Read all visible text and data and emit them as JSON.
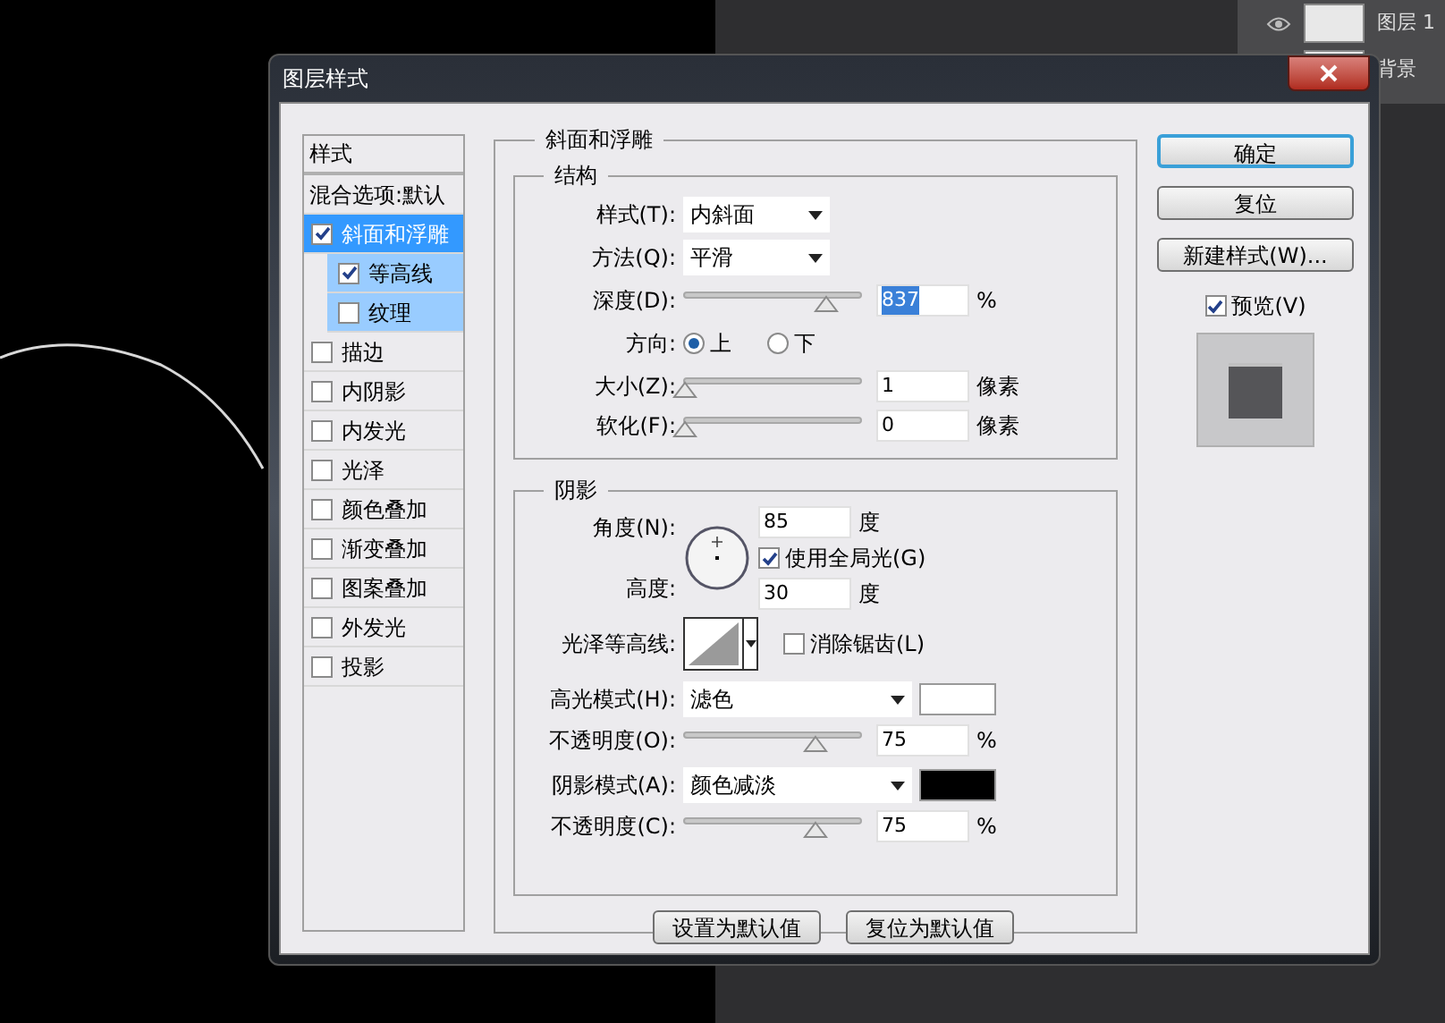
{
  "layers_panel": {
    "layers": [
      {
        "name": "图层 1"
      },
      {
        "name": "背景"
      }
    ]
  },
  "dialog": {
    "title": "图层样式",
    "styles_header": "样式",
    "styles": [
      {
        "kind": "header",
        "label": "混合选项:默认",
        "selected": false
      },
      {
        "kind": "checkbox",
        "label": "斜面和浮雕",
        "checked": true,
        "selected": true,
        "children": [
          {
            "label": "等高线",
            "checked": true
          },
          {
            "label": "纹理",
            "checked": false
          }
        ]
      },
      {
        "kind": "checkbox",
        "label": "描边",
        "checked": false,
        "selected": false
      },
      {
        "kind": "checkbox",
        "label": "内阴影",
        "checked": false,
        "selected": false
      },
      {
        "kind": "checkbox",
        "label": "内发光",
        "checked": false,
        "selected": false
      },
      {
        "kind": "checkbox",
        "label": "光泽",
        "checked": false,
        "selected": false
      },
      {
        "kind": "checkbox",
        "label": "颜色叠加",
        "checked": false,
        "selected": false
      },
      {
        "kind": "checkbox",
        "label": "渐变叠加",
        "checked": false,
        "selected": false
      },
      {
        "kind": "checkbox",
        "label": "图案叠加",
        "checked": false,
        "selected": false
      },
      {
        "kind": "checkbox",
        "label": "外发光",
        "checked": false,
        "selected": false
      },
      {
        "kind": "checkbox",
        "label": "投影",
        "checked": false,
        "selected": false
      }
    ],
    "section_title": "斜面和浮雕",
    "structure": {
      "title": "结构",
      "style": {
        "label": "样式(T):",
        "value": "内斜面"
      },
      "technique": {
        "label": "方法(Q):",
        "value": "平滑"
      },
      "depth": {
        "label": "深度(D):",
        "value": "837",
        "unit": "%",
        "level": 0.81,
        "highlighted": true
      },
      "direction": {
        "label": "方向:",
        "options": [
          {
            "label": "上",
            "selected": true
          },
          {
            "label": "下",
            "selected": false
          }
        ]
      },
      "size": {
        "label": "大小(Z):",
        "value": "1",
        "unit": "像素",
        "level": 0,
        "highlighted": false
      },
      "soften": {
        "label": "软化(F):",
        "value": "0",
        "unit": "像素",
        "level": 0,
        "highlighted": false
      }
    },
    "shading": {
      "title": "阴影",
      "angle": {
        "label": "角度(N):",
        "value": "85",
        "unit": "度"
      },
      "global_light": {
        "label": "使用全局光(G)",
        "checked": true
      },
      "altitude": {
        "label": "高度:",
        "value": "30",
        "unit": "度"
      },
      "gloss_contour": {
        "label": "光泽等高线:"
      },
      "anti_aliased": {
        "label": "消除锯齿(L)",
        "checked": false
      },
      "highlight_mode": {
        "label": "高光模式(H):",
        "value": "滤色",
        "color": "#ffffff"
      },
      "highlight_opacity": {
        "label": "不透明度(O):",
        "value": "75",
        "unit": "%",
        "level": 0.74,
        "highlighted": false
      },
      "shadow_mode": {
        "label": "阴影模式(A):",
        "value": "颜色减淡",
        "color": "#000000"
      },
      "shadow_opacity": {
        "label": "不透明度(C):",
        "value": "75",
        "unit": "%",
        "level": 0.74,
        "highlighted": false
      }
    },
    "default_buttons": [
      "设置为默认值",
      "复位为默认值"
    ],
    "actions": [
      {
        "kind": "default",
        "label": "确定"
      },
      {
        "kind": "normal",
        "label": "复位"
      },
      {
        "kind": "normal",
        "label": "新建样式(W)..."
      }
    ],
    "preview": {
      "label": "预览(V)",
      "checked": true
    }
  }
}
